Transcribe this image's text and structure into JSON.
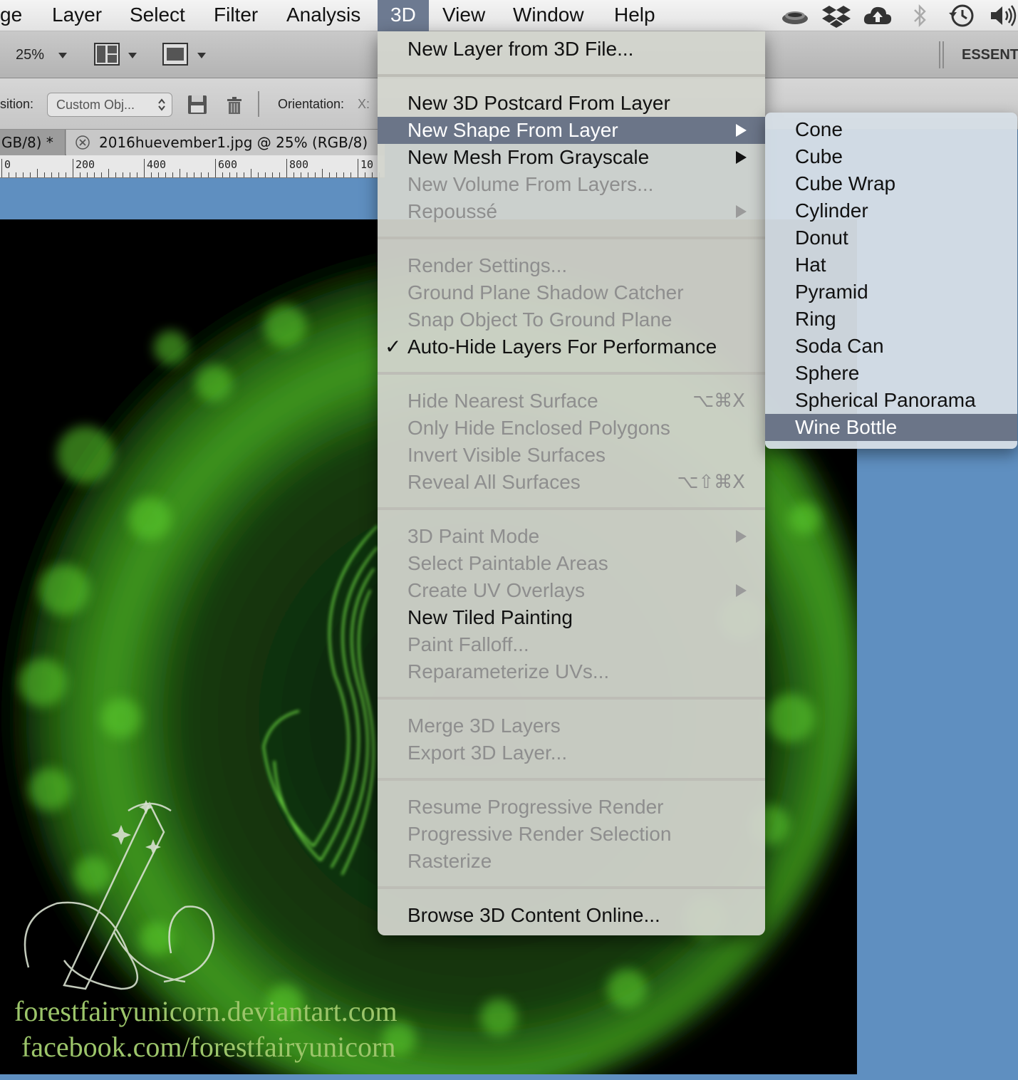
{
  "menubar": {
    "items": [
      "ge",
      "Layer",
      "Select",
      "Filter",
      "Analysis",
      "3D",
      "View",
      "Window",
      "Help"
    ],
    "status_icons": [
      "teacup-icon",
      "dropbox-icon",
      "cloud-upload-icon",
      "bluetooth-icon",
      "time-machine-icon",
      "volume-icon"
    ]
  },
  "toolbar": {
    "zoom": "25%",
    "workspace": "ESSENT"
  },
  "options_bar": {
    "position_label": "sition:",
    "preset_value": "Custom Obj...",
    "orientation_label": "Orientation:",
    "orientation_x": "X:"
  },
  "tabs": [
    {
      "title": "GB/8) *"
    },
    {
      "title": "2016huevember1.jpg @ 25% (RGB/8)"
    }
  ],
  "ruler": {
    "labels": [
      "0",
      "200",
      "400",
      "600",
      "800",
      "10"
    ]
  },
  "canvas": {
    "watermark_line1": "forestfairyunicorn.deviantart.com",
    "watermark_line2": "facebook.com/forestfairyunicorn"
  },
  "menu_3d": {
    "groups": [
      [
        {
          "label": "New Layer from 3D File...",
          "disabled": false
        }
      ],
      [
        {
          "label": "New 3D Postcard From Layer",
          "disabled": false
        },
        {
          "label": "New Shape From Layer",
          "disabled": false,
          "submenu": true,
          "highlighted": true
        },
        {
          "label": "New Mesh From Grayscale",
          "disabled": false,
          "submenu": true
        },
        {
          "label": "New Volume From Layers...",
          "disabled": true
        },
        {
          "label": "Repoussé",
          "disabled": true,
          "submenu": true
        }
      ],
      [
        {
          "label": "Render Settings...",
          "disabled": true
        },
        {
          "label": "Ground Plane Shadow Catcher",
          "disabled": true
        },
        {
          "label": "Snap Object To Ground Plane",
          "disabled": true
        },
        {
          "label": "Auto-Hide Layers For Performance",
          "disabled": false,
          "checked": true
        }
      ],
      [
        {
          "label": "Hide Nearest Surface",
          "disabled": true,
          "shortcut": "⌥⌘X"
        },
        {
          "label": "Only Hide Enclosed Polygons",
          "disabled": true
        },
        {
          "label": "Invert Visible Surfaces",
          "disabled": true
        },
        {
          "label": "Reveal All Surfaces",
          "disabled": true,
          "shortcut": "⌥⇧⌘X"
        }
      ],
      [
        {
          "label": "3D Paint Mode",
          "disabled": true,
          "submenu": true
        },
        {
          "label": "Select Paintable Areas",
          "disabled": true
        },
        {
          "label": "Create UV Overlays",
          "disabled": true,
          "submenu": true
        },
        {
          "label": "New Tiled Painting",
          "disabled": false
        },
        {
          "label": "Paint Falloff...",
          "disabled": true
        },
        {
          "label": "Reparameterize UVs...",
          "disabled": true
        }
      ],
      [
        {
          "label": "Merge 3D Layers",
          "disabled": true
        },
        {
          "label": "Export 3D Layer...",
          "disabled": true
        }
      ],
      [
        {
          "label": "Resume Progressive Render",
          "disabled": true
        },
        {
          "label": "Progressive Render Selection",
          "disabled": true
        },
        {
          "label": "Rasterize",
          "disabled": true
        }
      ],
      [
        {
          "label": "Browse 3D Content Online...",
          "disabled": false
        }
      ]
    ]
  },
  "shape_submenu": {
    "items": [
      "Cone",
      "Cube",
      "Cube Wrap",
      "Cylinder",
      "Donut",
      "Hat",
      "Pyramid",
      "Ring",
      "Soda Can",
      "Sphere",
      "Spherical Panorama",
      "Wine Bottle"
    ],
    "highlighted": "Wine Bottle"
  },
  "colors": {
    "menu_highlight": "#6b7588",
    "disabled_text": "#8e8e8e",
    "canvas_glow": "#5ed42e",
    "workspace_bg": "#5f8fc0"
  }
}
